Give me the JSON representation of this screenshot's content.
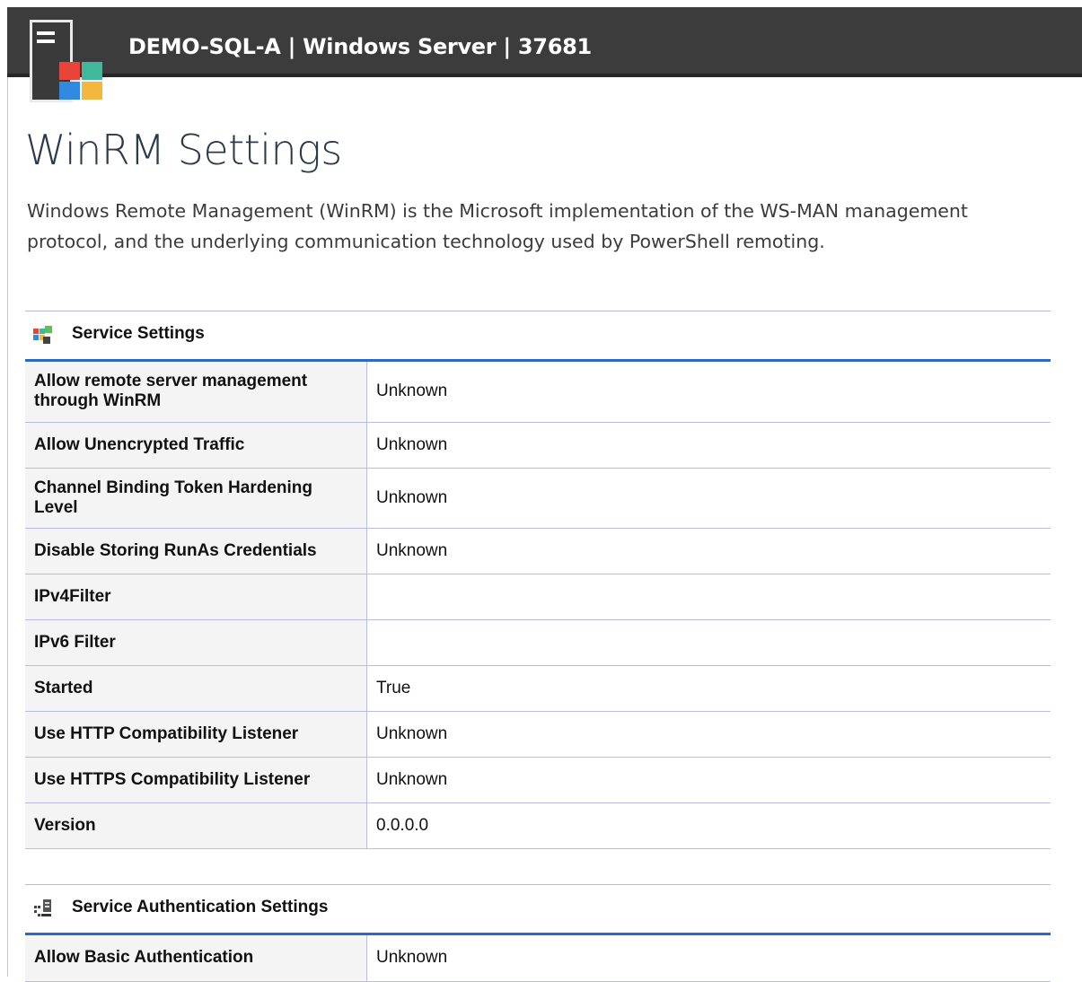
{
  "header": {
    "title": "DEMO-SQL-A | Windows Server | 37681",
    "logo_icon": "server-windows-logo-icon"
  },
  "page": {
    "title": "WinRM Settings",
    "description": "Windows Remote Management (WinRM) is the Microsoft implementation of the WS-MAN management protocol, and the underlying communication technology used by PowerShell remoting."
  },
  "sections": [
    {
      "title": "Service Settings",
      "icon": "windows-server-settings-icon",
      "rows": [
        {
          "label": "Allow remote server management through WinRM",
          "value": "Unknown"
        },
        {
          "label": "Allow Unencrypted Traffic",
          "value": "Unknown"
        },
        {
          "label": "Channel Binding Token Hardening Level",
          "value": "Unknown"
        },
        {
          "label": "Disable Storing RunAs Credentials",
          "value": "Unknown"
        },
        {
          "label": "IPv4Filter",
          "value": ""
        },
        {
          "label": "IPv6 Filter",
          "value": ""
        },
        {
          "label": "Started",
          "value": "True"
        },
        {
          "label": "Use HTTP Compatibility Listener",
          "value": "Unknown"
        },
        {
          "label": "Use HTTPS Compatibility Listener",
          "value": "Unknown"
        },
        {
          "label": "Version",
          "value": "0.0.0.0"
        }
      ]
    },
    {
      "title": "Service Authentication Settings",
      "icon": "network-server-auth-icon",
      "rows": [
        {
          "label": "Allow Basic Authentication",
          "value": "Unknown"
        }
      ]
    }
  ],
  "colors": {
    "header_bg": "#3c3c3c",
    "accent_rule": "#2b68c9",
    "row_border": "#b8bce6",
    "label_bg": "#f4f4f4"
  }
}
